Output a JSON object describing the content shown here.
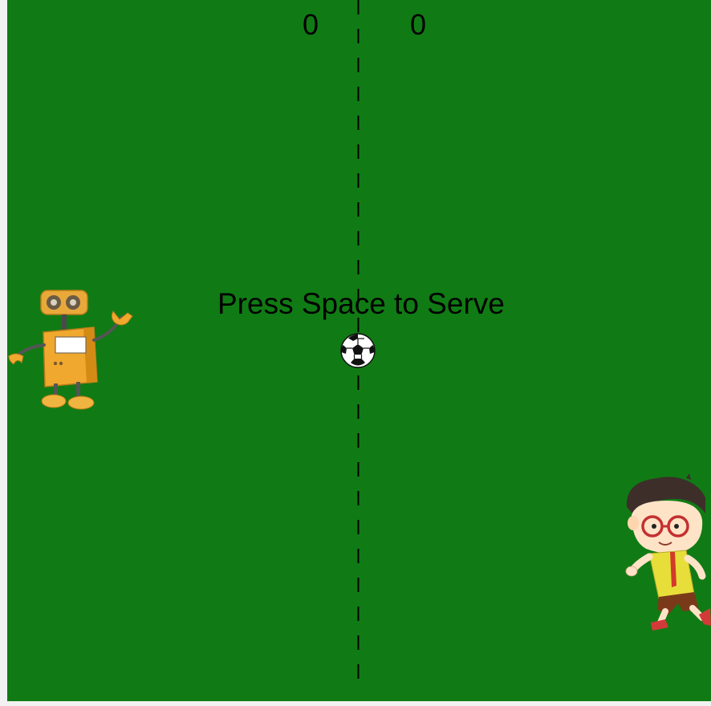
{
  "scoreboard": {
    "left_score": "0",
    "right_score": "0"
  },
  "prompt": {
    "serve_text": "Press Space to Serve"
  },
  "players": {
    "left": "robot-player",
    "right": "boy-player"
  },
  "ball": "soccer-ball-icon",
  "colors": {
    "field": "#107b14",
    "line": "#000000",
    "text": "#000000",
    "page_background": "#f2f2f2"
  }
}
